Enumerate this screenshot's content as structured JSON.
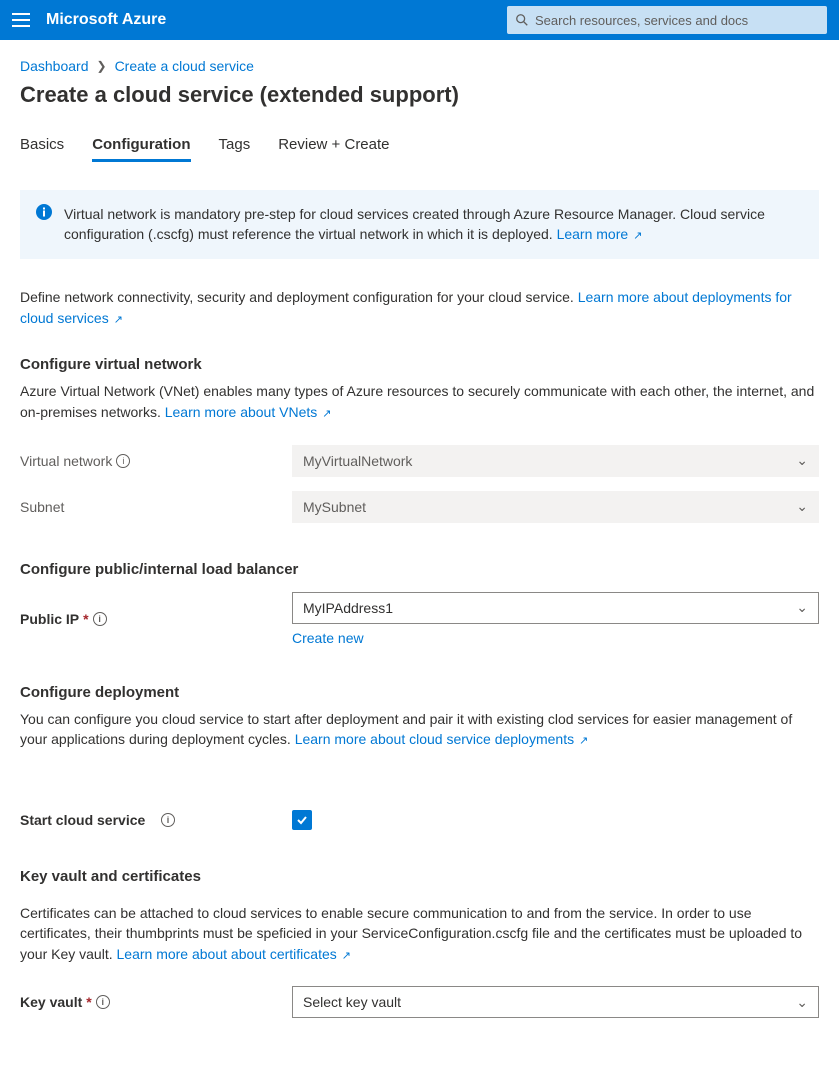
{
  "top": {
    "brand": "Microsoft Azure",
    "search_placeholder": "Search resources, services and docs"
  },
  "breadcrumb": {
    "dashboard": "Dashboard",
    "current": "Create a cloud service"
  },
  "page_title": "Create a cloud service (extended support)",
  "tabs": {
    "basics": "Basics",
    "configuration": "Configuration",
    "tags": "Tags",
    "review": "Review + Create"
  },
  "info": {
    "text": "Virtual network is mandatory pre-step for cloud services created through Azure Resource Manager. Cloud service configuration (.cscfg) must reference the virtual network in which it is deployed. ",
    "learn_more": "Learn more"
  },
  "intro": {
    "text": "Define network connectivity, security and deployment configuration for your cloud service. ",
    "learn_more": "Learn more about deployments for cloud services"
  },
  "vnet": {
    "heading": "Configure virtual network",
    "desc": "Azure Virtual Network (VNet) enables many types of Azure resources to securely communicate with each other, the internet, and on-premises networks. ",
    "learn_more": "Learn more about VNets",
    "label_vnet": "Virtual network",
    "value_vnet": "MyVirtualNetwork",
    "label_subnet": "Subnet",
    "value_subnet": "MySubnet"
  },
  "lb": {
    "heading": "Configure public/internal load balancer",
    "label_publicip": "Public IP",
    "value_publicip": "MyIPAddress1",
    "create_new": "Create new"
  },
  "deploy": {
    "heading": "Configure deployment",
    "desc": "You can configure you cloud service to start after deployment and pair it with existing clod services for easier management of your applications during deployment cycles. ",
    "learn_more": "Learn more about cloud service deployments",
    "label_start": "Start cloud service"
  },
  "kv": {
    "heading": "Key vault and certificates",
    "desc": "Certificates can be attached to cloud services to enable secure communication to and from the service. In order to use certificates, their thumbprints must be speficied in your ServiceConfiguration.cscfg file and the certificates must be uploaded to your Key vault. ",
    "learn_more": "Learn more about about certificates",
    "label_kv": "Key vault",
    "value_kv": "Select key vault"
  }
}
